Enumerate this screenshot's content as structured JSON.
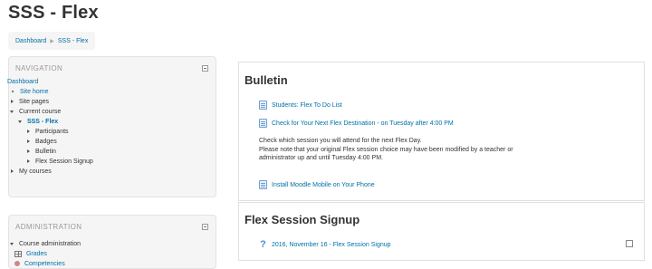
{
  "page": {
    "title": "SSS - Flex"
  },
  "breadcrumb": {
    "items": [
      "Dashboard",
      "SSS - Flex"
    ]
  },
  "navigation": {
    "title": "NAVIGATION",
    "dashboard": "Dashboard",
    "site_home": "Site home",
    "site_pages": "Site pages",
    "current_course": "Current course",
    "course": "SSS - Flex",
    "children": [
      "Participants",
      "Badges",
      "Bulletin",
      "Flex Session Signup"
    ],
    "my_courses": "My courses"
  },
  "administration": {
    "title": "ADMINISTRATION",
    "course_admin": "Course administration",
    "grades": "Grades",
    "competencies": "Competencies"
  },
  "bulletin": {
    "title": "Bulletin",
    "activities": [
      "Students: Flex To Do List",
      "Check for Your Next Flex Destination - on Tuesday after 4:00 PM"
    ],
    "description": [
      "Check which session you will attend for the next Flex Day.",
      "Please note that your original Flex session choice may have been modified by a teacher or",
      "administrator up and until Tuesday 4:00 PM."
    ],
    "install_link": "Install Moodle Mobile on Your Phone"
  },
  "flex_signup": {
    "title": "Flex Session Signup",
    "activity": "2016, November 16 - Flex Session Signup"
  },
  "icons": {
    "page": "doc-icon",
    "question": "question-icon",
    "collapse": "collapse-icon"
  },
  "colors": {
    "link": "#0070a8",
    "block_bg": "#f5f5f5"
  }
}
